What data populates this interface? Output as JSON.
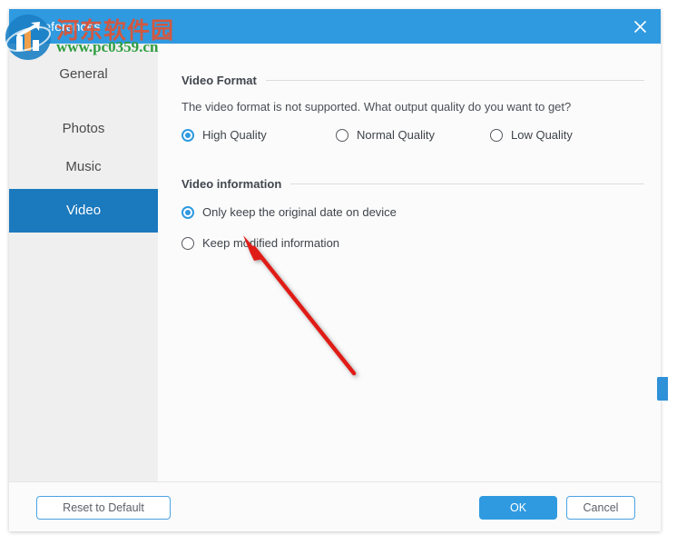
{
  "window": {
    "title": "Preferences",
    "close_icon": "close-icon"
  },
  "sidebar": {
    "items": [
      {
        "label": "General",
        "active": false
      },
      {
        "label": "Photos",
        "active": false
      },
      {
        "label": "Music",
        "active": false
      },
      {
        "label": "Video",
        "active": true
      }
    ]
  },
  "content": {
    "video_format": {
      "title": "Video Format",
      "description": "The video format is not supported. What output quality do you want to get?",
      "options": [
        {
          "label": "High Quality",
          "selected": true
        },
        {
          "label": "Normal Quality",
          "selected": false
        },
        {
          "label": "Low Quality",
          "selected": false
        }
      ]
    },
    "video_information": {
      "title": "Video information",
      "options": [
        {
          "label": "Only keep the original date on device",
          "selected": true
        },
        {
          "label": "Keep modified information",
          "selected": false
        }
      ]
    }
  },
  "footer": {
    "reset_label": "Reset to Default",
    "ok_label": "OK",
    "cancel_label": "Cancel"
  },
  "watermark": {
    "site_cn": "河东软件园",
    "site_url": "www.pc0359.cn"
  },
  "colors": {
    "titlebar": "#2f9ae0",
    "accent": "#2f9ae0",
    "sidebar_active": "#1b79bd",
    "sidebar_bg": "#efefef",
    "annotation": "#e01b16",
    "watermark_cn": "#e8502a",
    "watermark_url": "#2e9e3e"
  }
}
